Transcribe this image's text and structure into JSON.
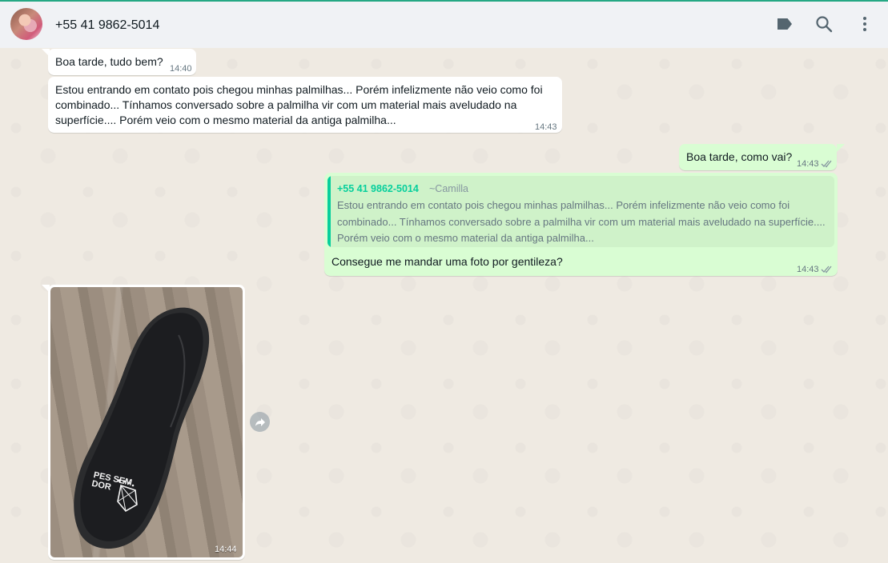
{
  "header": {
    "contact_name": "+55 41 9862-5014",
    "icons": [
      "label-icon",
      "search-icon",
      "menu-icon"
    ]
  },
  "messages": [
    {
      "direction": "in",
      "text": "Boa tarde, tudo bem?",
      "time": "14:40"
    },
    {
      "direction": "in",
      "text": "Estou entrando em contato pois chegou minhas palmilhas... Porém infelizmente não veio como foi combinado... Tínhamos conversado sobre a palmilha vir com um material mais aveludado na superfície.... Porém veio com o mesmo material da antiga palmilha...",
      "time": "14:43"
    },
    {
      "direction": "out",
      "text": "Boa tarde, como vai?",
      "time": "14:43",
      "status": "read"
    },
    {
      "direction": "out",
      "quote": {
        "author": "+55 41 9862-5014",
        "push_name": "~Camilla",
        "text": "Estou entrando em contato pois chegou minhas palmilhas... Porém infelizmente não veio como foi combinado... Tínhamos conversado sobre a palmilha vir com um material mais aveludado na superfície.... Porém veio com o mesmo material da antiga palmilha..."
      },
      "text": "Consegue me mandar uma foto por gentileza?",
      "time": "14:43",
      "status": "read"
    },
    {
      "direction": "in",
      "type": "image",
      "image_logo_text": "PES SEM DOR",
      "time": "14:44"
    }
  ],
  "colors": {
    "outgoing_bubble": "#d9fdd3",
    "incoming_bubble": "#ffffff",
    "quote_accent": "#06cf9c",
    "chat_background": "#efeae2",
    "header_background": "#f0f2f5"
  }
}
